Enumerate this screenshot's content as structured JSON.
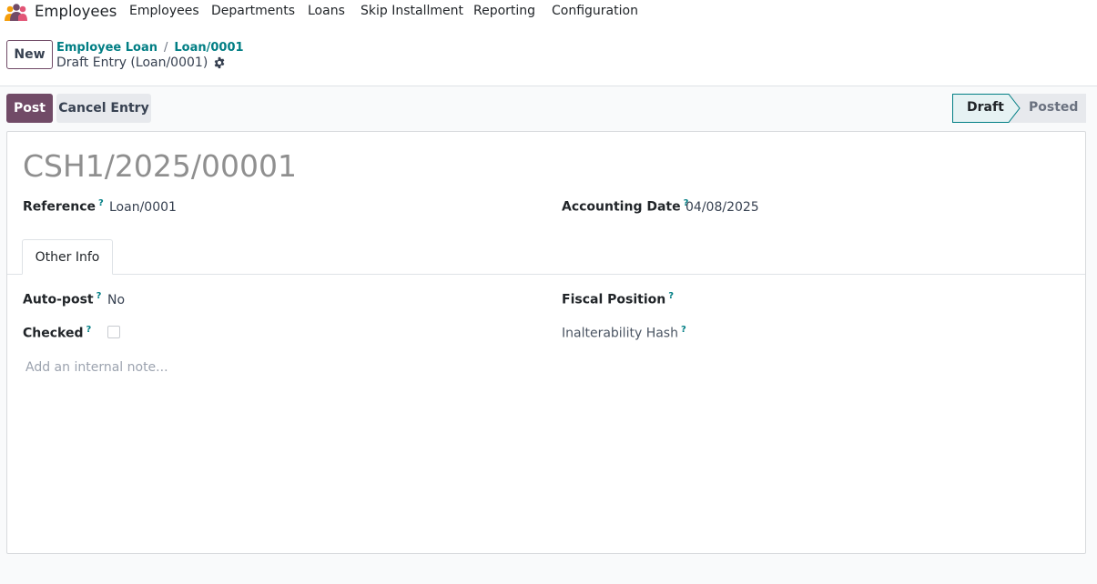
{
  "navbar": {
    "app_name": "Employees",
    "menu": [
      "Employees",
      "Departments",
      "Loans",
      "Skip Installment",
      "Reporting",
      "Configuration"
    ]
  },
  "control_panel": {
    "new_label": "New",
    "breadcrumb": [
      "Employee Loan",
      "Loan/0001"
    ],
    "breadcrumb_sep": "/",
    "record_title": "Draft Entry (Loan/0001)"
  },
  "actions": {
    "post_label": "Post",
    "cancel_label": "Cancel Entry"
  },
  "statusbar": {
    "stages": [
      "Draft",
      "Posted"
    ],
    "active": "Draft"
  },
  "form": {
    "name": "CSH1/2025/00001",
    "reference_label": "Reference",
    "reference_value": "Loan/0001",
    "accounting_date_label": "Accounting Date",
    "accounting_date_value": "04/08/2025",
    "tab_label": "Other Info",
    "auto_post_label": "Auto-post",
    "auto_post_value": "No",
    "checked_label": "Checked",
    "checked_value": false,
    "fiscal_position_label": "Fiscal Position",
    "inalterability_hash_label": "Inalterability Hash",
    "note_placeholder": "Add an internal note...",
    "help_mark": "?"
  },
  "colors": {
    "brand": "#714b67",
    "link": "#017e84"
  }
}
